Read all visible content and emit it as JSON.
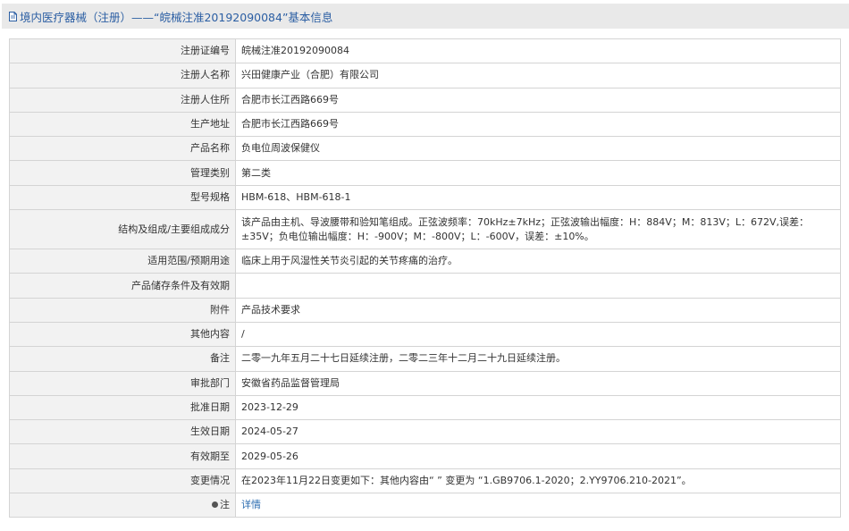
{
  "header": {
    "title": "境内医疗器械（注册）——“皖械注准20192090084”基本信息",
    "icon": "document-icon"
  },
  "rows": [
    {
      "label": "注册证编号",
      "value": "皖械注准20192090084"
    },
    {
      "label": "注册人名称",
      "value": "兴田健康产业（合肥）有限公司"
    },
    {
      "label": "注册人住所",
      "value": "合肥市长江西路669号"
    },
    {
      "label": "生产地址",
      "value": "合肥市长江西路669号"
    },
    {
      "label": "产品名称",
      "value": "负电位周波保健仪"
    },
    {
      "label": "管理类别",
      "value": "第二类"
    },
    {
      "label": "型号规格",
      "value": "HBM-618、HBM-618-1"
    },
    {
      "label": "结构及组成/主要组成成分",
      "value": "该产品由主机、导波腰带和验知笔组成。正弦波频率：70kHz±7kHz；正弦波输出幅度：H：884V；M：813V；L：672V,误差：±35V；负电位输出幅度：H：-900V；M：-800V；L：-600V，误差：±10%。"
    },
    {
      "label": "适用范围/预期用途",
      "value": "临床上用于风湿性关节炎引起的关节疼痛的治疗。"
    },
    {
      "label": "产品储存条件及有效期",
      "value": ""
    },
    {
      "label": "附件",
      "value": "产品技术要求"
    },
    {
      "label": "其他内容",
      "value": "/"
    },
    {
      "label": "备注",
      "value": "二零一九年五月二十七日延续注册，二零二三年十二月二十九日延续注册。"
    },
    {
      "label": "审批部门",
      "value": "安徽省药品监督管理局"
    },
    {
      "label": "批准日期",
      "value": "2023-12-29"
    },
    {
      "label": "生效日期",
      "value": "2024-05-27"
    },
    {
      "label": "有效期至",
      "value": "2029-05-26"
    },
    {
      "label": "变更情况",
      "value": "在2023年11月22日变更如下：其他内容由“ ” 变更为 “1.GB9706.1-2020；2.YY9706.210-2021”。"
    }
  ],
  "note": {
    "label": "注",
    "icon": "info-dot-icon",
    "link_text": "详情"
  }
}
